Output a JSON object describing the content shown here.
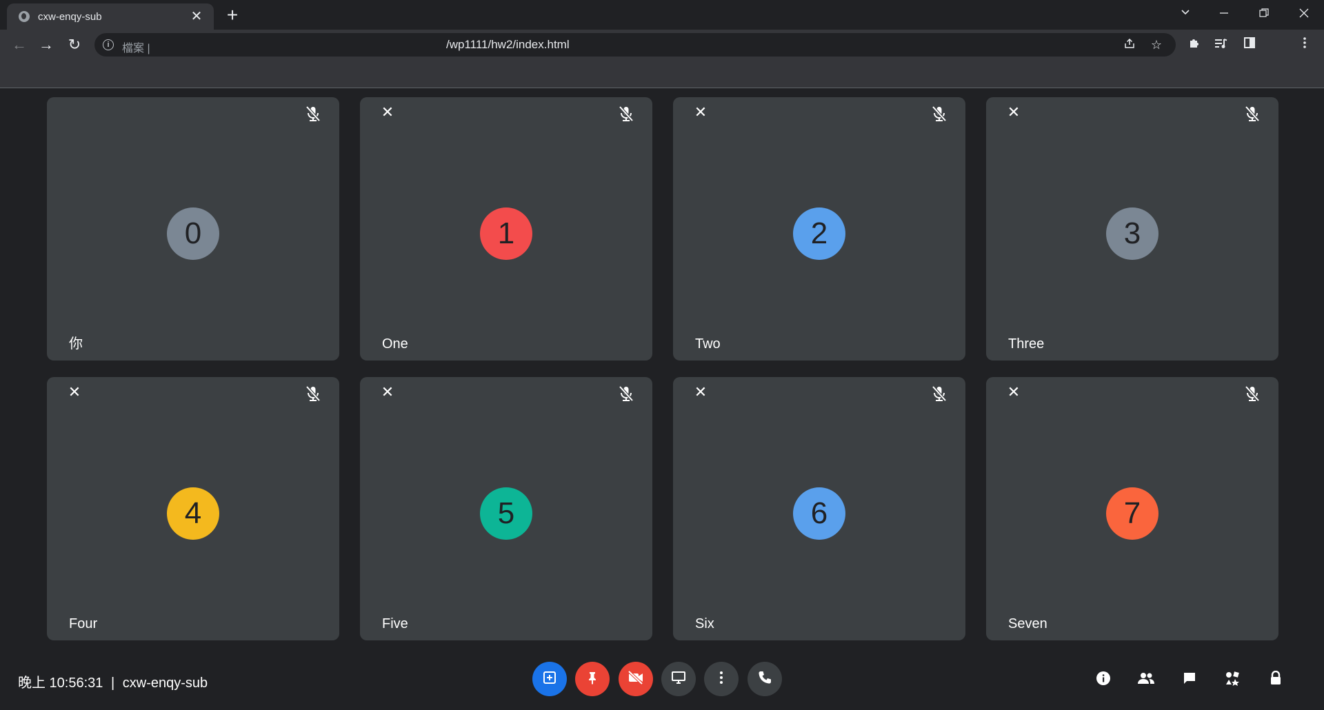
{
  "browser": {
    "tab_title": "cxw-enqy-sub",
    "tab_close": "✕",
    "new_tab": "+",
    "minimize": "—",
    "restore": "❐",
    "close": "✕",
    "tabs_dropdown": "⌄",
    "omnibox_scheme": "檔案 |",
    "omnibox_url": "/wp1111/hw2/index.html",
    "back": "←",
    "forward": "→",
    "reload": "↻"
  },
  "tiles": [
    {
      "initial": "0",
      "name": "你",
      "color": "#7b8794",
      "closable": false
    },
    {
      "initial": "1",
      "name": "One",
      "color": "#f34c4c",
      "closable": true
    },
    {
      "initial": "2",
      "name": "Two",
      "color": "#5aa0ec",
      "closable": true
    },
    {
      "initial": "3",
      "name": "Three",
      "color": "#7b8794",
      "closable": true
    },
    {
      "initial": "4",
      "name": "Four",
      "color": "#f4b91e",
      "closable": true
    },
    {
      "initial": "5",
      "name": "Five",
      "color": "#0db596",
      "closable": true
    },
    {
      "initial": "6",
      "name": "Six",
      "color": "#5aa0ec",
      "closable": true
    },
    {
      "initial": "7",
      "name": "Seven",
      "color": "#fa653d",
      "closable": true
    }
  ],
  "tile_close_glyph": "✕",
  "bottom_bar": {
    "time_label": "晚上 10:56:31",
    "separator": "|",
    "meeting_code": "cxw-enqy-sub"
  }
}
